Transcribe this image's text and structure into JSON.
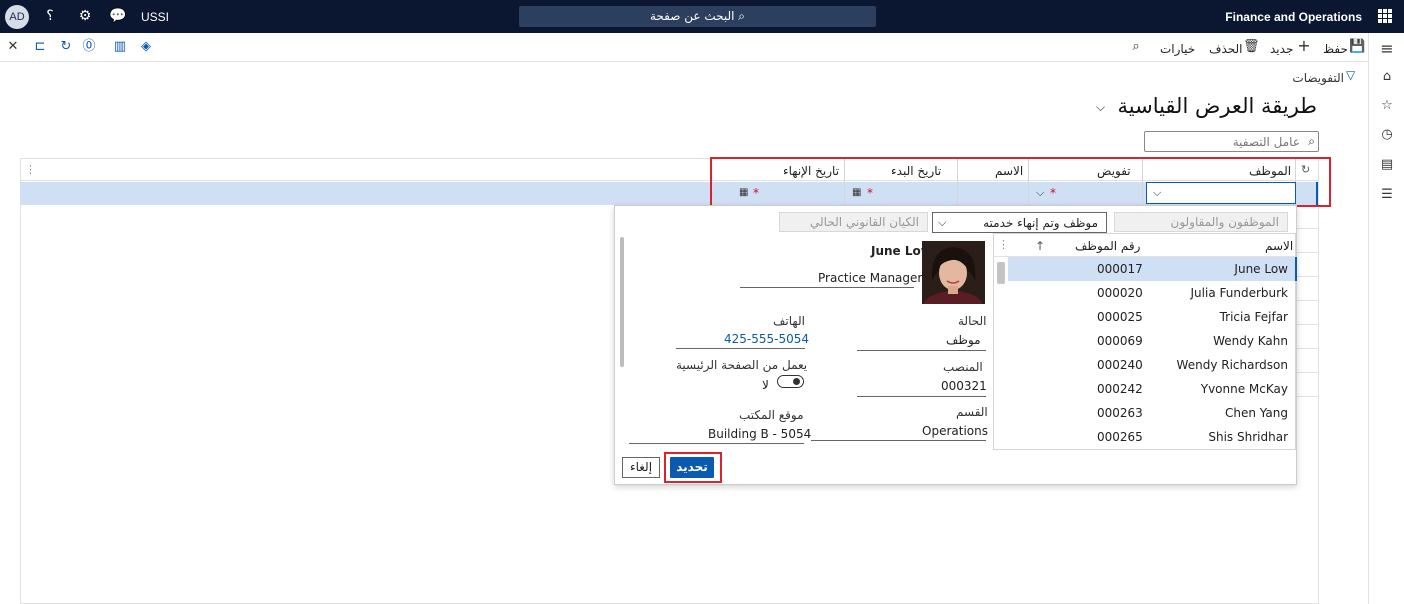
{
  "topbar": {
    "avatar": "AD",
    "help": "؟",
    "company": "USSI",
    "search": "البحث عن صفحة",
    "app_name": "Finance and Operations"
  },
  "actionbar": {
    "save": "حفظ",
    "new": "جديد",
    "delete": "الحذف",
    "options": "خيارات"
  },
  "page": {
    "breadcrumb": "التفويضات",
    "title": "طريقة العرض القياسية",
    "filter_placeholder": "عامل التصفية"
  },
  "grid": {
    "columns": [
      "الموظف",
      "تفويض",
      "الاسم",
      "تاريخ البدء",
      "تاريخ الإنهاء"
    ]
  },
  "lookup": {
    "tab_employees": "الموظفون والمقاولون",
    "status_value": "موظف وتم إنهاء خدمته",
    "legal_entity": "الكيان القانوني الحالي",
    "list_headers": {
      "name": "الاسم",
      "number": "رقم الموظف"
    },
    "rows": [
      {
        "name": "June Low",
        "number": "000017"
      },
      {
        "name": "Julia Funderburk",
        "number": "000020"
      },
      {
        "name": "Tricia Fejfar",
        "number": "000025"
      },
      {
        "name": "Wendy Kahn",
        "number": "000069"
      },
      {
        "name": "Wendy Richardson",
        "number": "000240"
      },
      {
        "name": "Yvonne McKay",
        "number": "000242"
      },
      {
        "name": "Chen Yang",
        "number": "000263"
      },
      {
        "name": "Shis Shridhar",
        "number": "000265"
      }
    ],
    "card": {
      "name": "June Low",
      "job_title": "Practice Manager",
      "status_label": "الحالة",
      "status_value": "موظف",
      "phone_label": "الهاتف",
      "phone_value": "425-555-5054",
      "position_label": "المنصب",
      "position_value": "000321",
      "home_label": "يعمل من الصفحة الرئيسية",
      "home_value": "لا",
      "dept_label": "القسم",
      "dept_value": "Operations",
      "office_label": "موقع المكتب",
      "office_value": "Building B - 5054"
    },
    "cancel": "إلغاء",
    "select": "تحديد"
  },
  "colors": {
    "accent": "#0b5ab0",
    "nav": "#0b1730",
    "highlight": "#d9232e"
  }
}
